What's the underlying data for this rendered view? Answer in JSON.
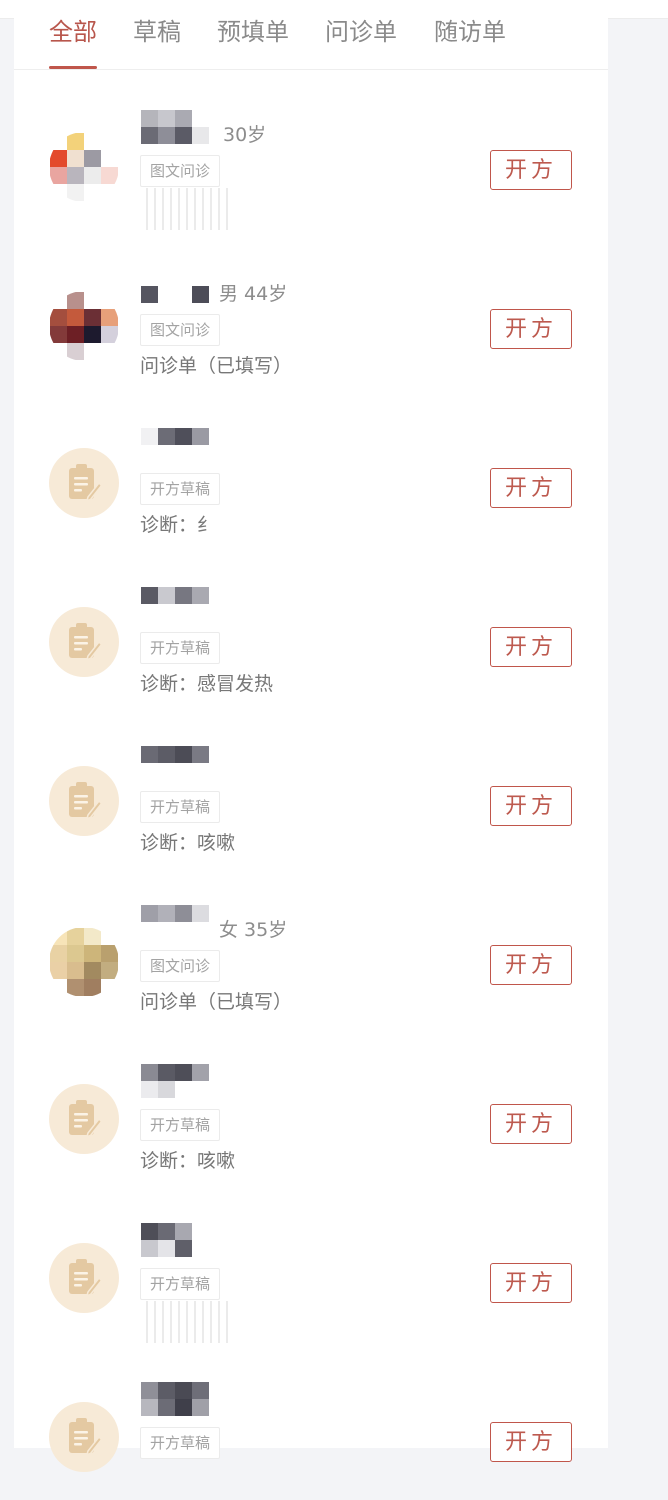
{
  "tabs": [
    {
      "label": "全部",
      "active": true
    },
    {
      "label": "草稿",
      "active": false
    },
    {
      "label": "预填单",
      "active": false
    },
    {
      "label": "问诊单",
      "active": false
    },
    {
      "label": "随访单",
      "active": false
    }
  ],
  "colors": {
    "accent": "#c0564b",
    "draft_avatar_bg": "#f7ead7",
    "draft_icon": "#e4c9a2"
  },
  "rows": [
    {
      "kind": "photo",
      "meta": "30岁",
      "tag": "图文问诊",
      "desc": "",
      "button": "开方"
    },
    {
      "kind": "photo",
      "meta": "男 44岁",
      "tag": "图文问诊",
      "desc": "问诊单（已填写）",
      "button": "开方"
    },
    {
      "kind": "draft",
      "meta": "",
      "tag": "开方草稿",
      "desc": "诊断：纟",
      "button": "开方",
      "icon": "clipboard-icon"
    },
    {
      "kind": "draft",
      "meta": "",
      "tag": "开方草稿",
      "desc": "诊断：感冒发热",
      "button": "开方",
      "icon": "clipboard-icon"
    },
    {
      "kind": "draft",
      "meta": "",
      "tag": "开方草稿",
      "desc": "诊断：咳嗽",
      "button": "开方",
      "icon": "clipboard-icon"
    },
    {
      "kind": "photo",
      "meta": "女 35岁",
      "tag": "图文问诊",
      "desc": "问诊单（已填写）",
      "button": "开方"
    },
    {
      "kind": "draft",
      "meta": "",
      "tag": "开方草稿",
      "desc": "诊断：咳嗽",
      "button": "开方",
      "icon": "clipboard-icon"
    },
    {
      "kind": "draft",
      "meta": "",
      "tag": "开方草稿",
      "desc": "",
      "button": "开方",
      "icon": "clipboard-icon"
    },
    {
      "kind": "draft",
      "meta": "",
      "tag": "开方草稿",
      "desc": "",
      "button": "开方",
      "icon": "clipboard-icon"
    }
  ]
}
